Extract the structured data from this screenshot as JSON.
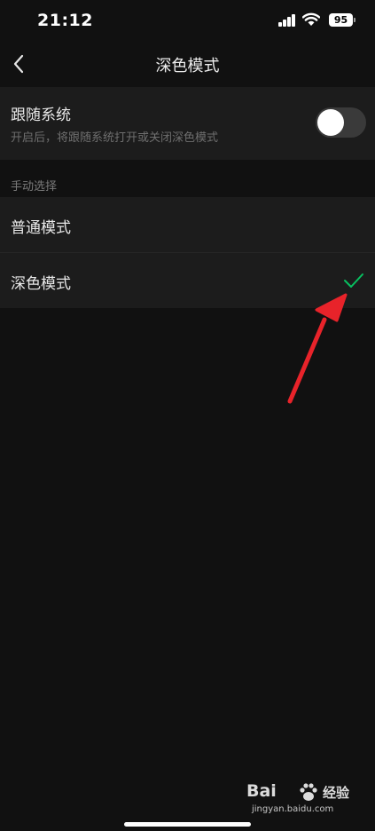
{
  "status_bar": {
    "time": "21:12",
    "battery": "95"
  },
  "nav": {
    "title": "深色模式",
    "back_icon": "chevron-left-icon"
  },
  "follow_system": {
    "title": "跟随系统",
    "description": "开启后，将跟随系统打开或关闭深色模式",
    "enabled": false
  },
  "manual": {
    "header": "手动选择",
    "options": [
      {
        "label": "普通模式",
        "selected": false
      },
      {
        "label": "深色模式",
        "selected": true
      }
    ]
  },
  "watermark": {
    "brand": "Bai",
    "brand_suffix": "经验",
    "url": "jingyan.baidu.com"
  },
  "colors": {
    "accent_check": "#07c160",
    "annotation_arrow": "#e8232a",
    "row_bg": "#1c1c1c",
    "page_bg": "#111111"
  }
}
